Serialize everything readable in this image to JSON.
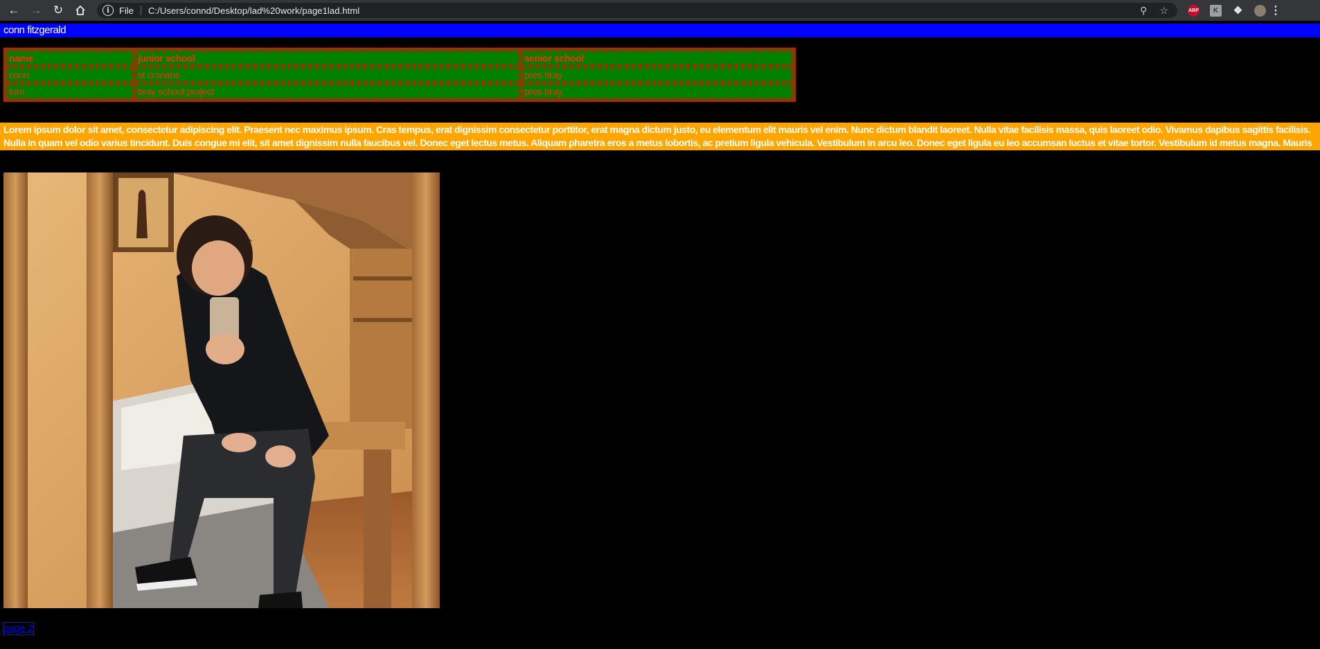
{
  "browser": {
    "back_icon": "arrow-left-icon",
    "forward_icon": "arrow-right-icon",
    "reload_icon": "reload-icon",
    "home_icon": "home-icon",
    "scheme_label": "File",
    "url": "C:/Users/connd/Desktop/lad%20work/page1lad.html",
    "extensions": {
      "abp_label": "ABP",
      "gray_ext_label": "K"
    }
  },
  "page": {
    "title": "conn fitzgerald",
    "title_bg": "#0000ff",
    "table_bg": "#008000",
    "table_text_color": "#ff2a00",
    "table": {
      "headers": [
        "name",
        "junior school",
        "senior school"
      ],
      "rows": [
        [
          "conn",
          "st cronans",
          "pres bray"
        ],
        [
          "tom",
          "bray school project",
          "pres bray"
        ]
      ]
    },
    "lorem_bg": "#ffa500",
    "lorem": "Lorem ipsum dolor sit amet, consectetur adipiscing elit. Praesent nec maximus ipsum. Cras tempus, erat dignissim consectetur porttitor, erat magna dictum justo, eu elementum elit mauris vel enim. Nunc dictum blandit laoreet. Nulla vitae facilisis massa, quis laoreet odio. Vivamus dapibus sagittis facilisis. Nulla in quam vel odio varius tincidunt. Duis congue mi elit, sit amet dignissim nulla faucibus vel. Donec eget lectus metus. Aliquam pharetra eros a metus lobortis, ac pretium ligula vehicula. Vestibulum in arcu leo. Donec eget ligula eu leo accumsan luctus et vitae tortor. Vestibulum id metus magna. Mauris",
    "link_label": "page 2",
    "link_color": "#0000ee"
  }
}
